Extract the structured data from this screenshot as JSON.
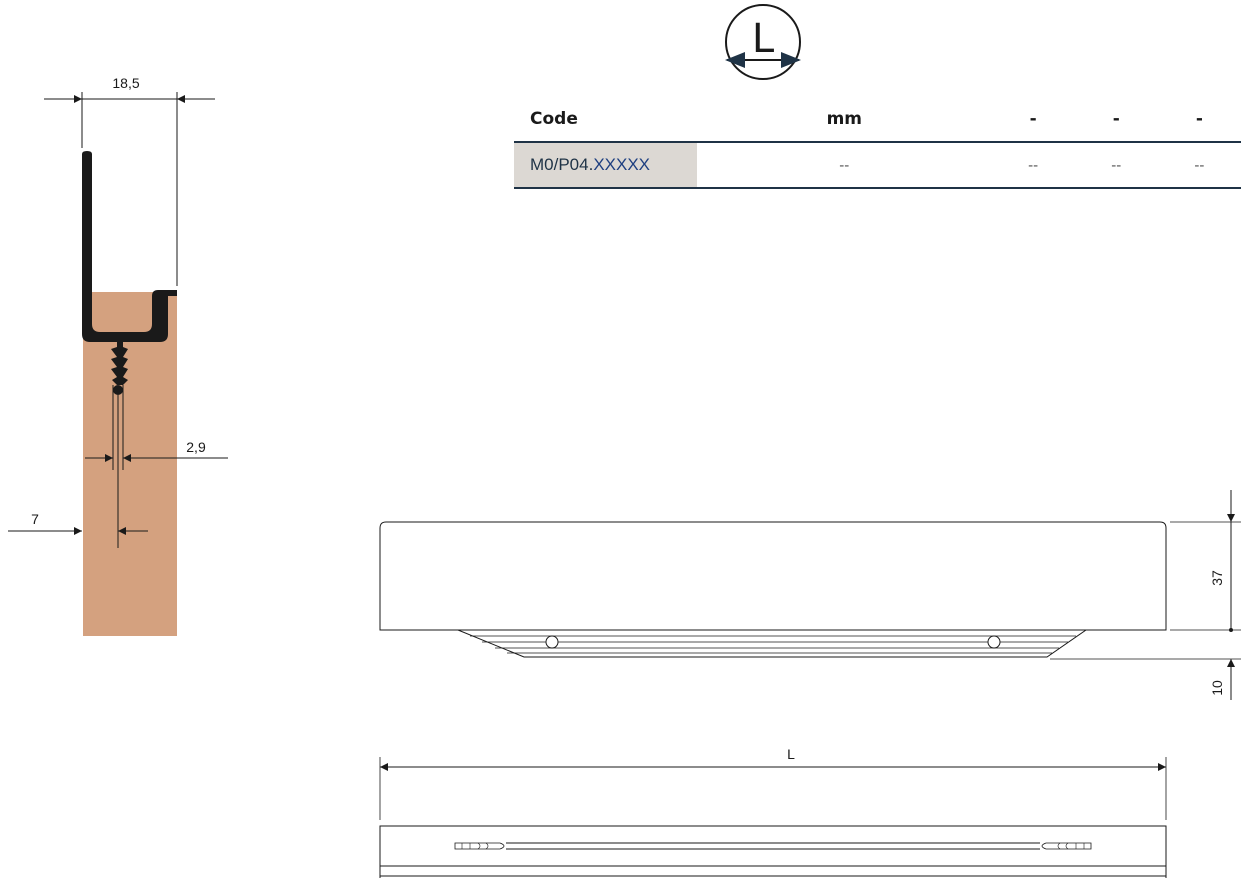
{
  "profile_section": {
    "dimensions": {
      "width": "18,5",
      "screw_width": "2,9",
      "screw_offset": "7"
    }
  },
  "length_symbol": {
    "letter": "L"
  },
  "spec_table": {
    "headers": [
      "Code",
      "mm",
      "-",
      "-",
      "-"
    ],
    "row": {
      "code_prefix": "M0/P04.",
      "code_suffix": "XXXXX",
      "values": [
        "--",
        "--",
        "--",
        "--"
      ]
    }
  },
  "front_view": {
    "dimensions": {
      "height": "37",
      "lip": "10"
    }
  },
  "top_view": {
    "dimensions": {
      "length": "L"
    }
  },
  "colors": {
    "wood": "#d4a17f",
    "profile": "#1a1a1a",
    "table_rule": "#1f3346",
    "code_cell": "#dcd8d3",
    "code_text": "#1e3f80"
  }
}
